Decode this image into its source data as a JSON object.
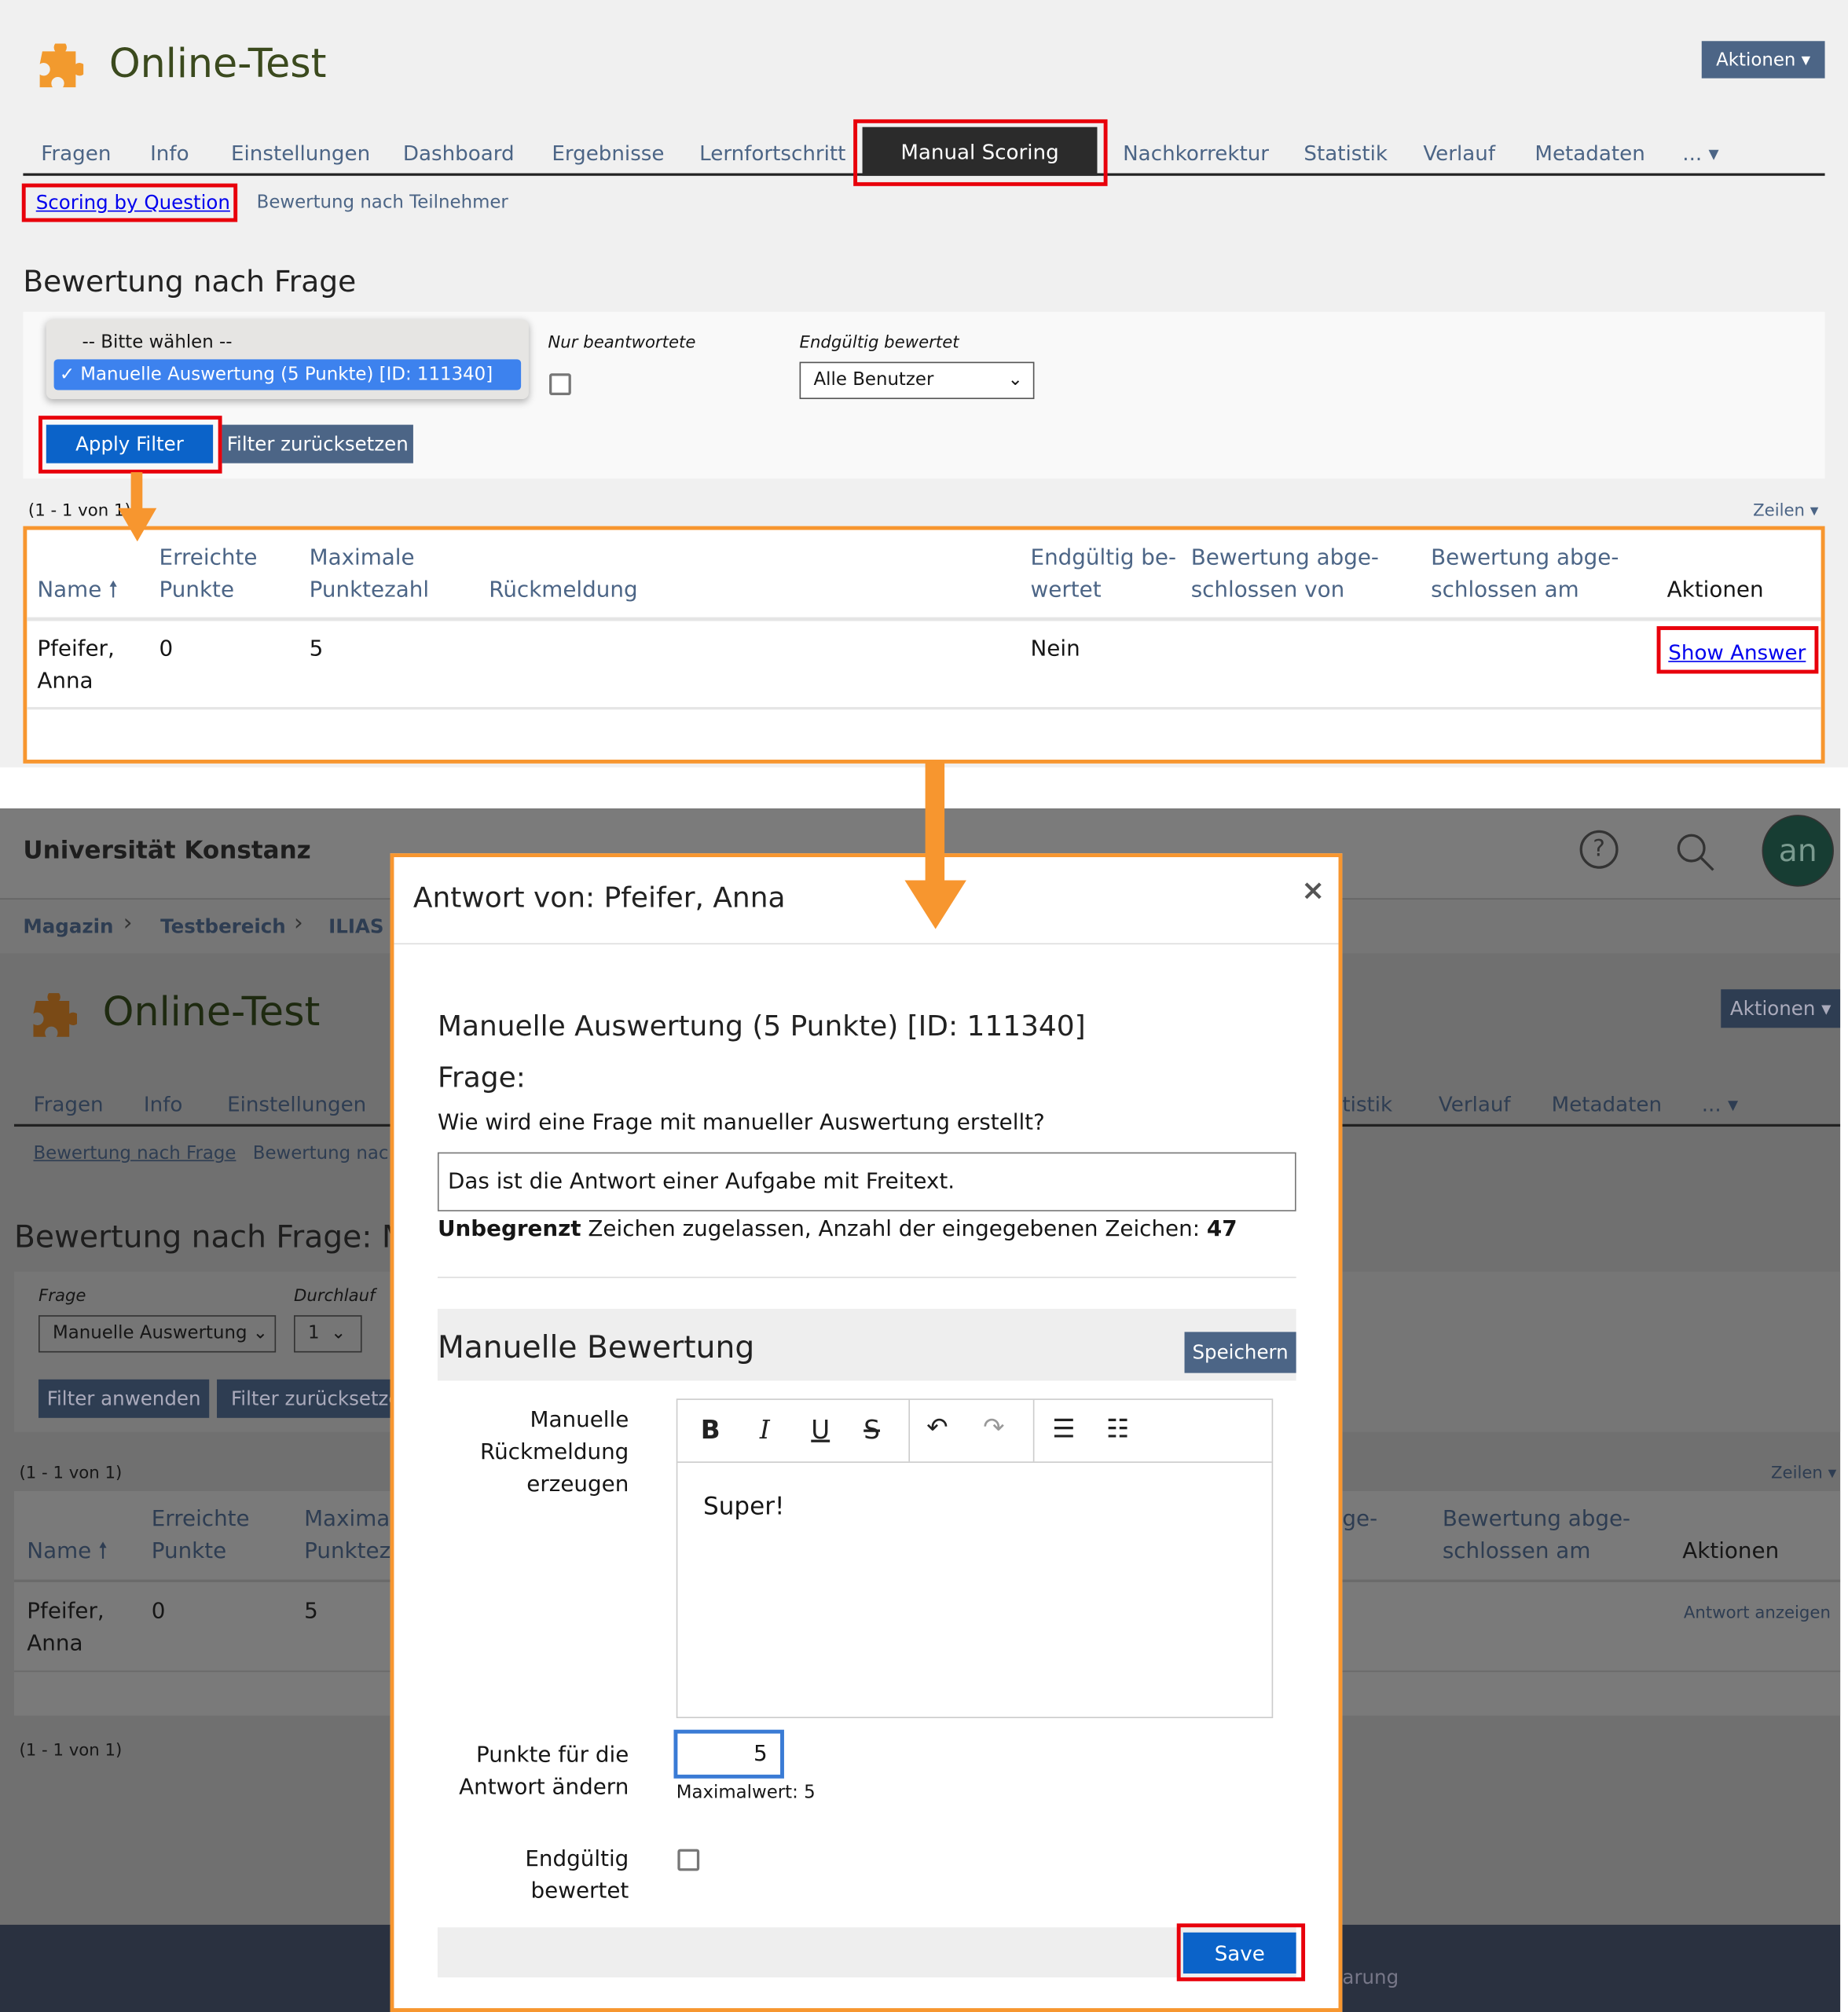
{
  "top": {
    "title": "Online-Test",
    "actions_label": "Aktionen",
    "tabs": [
      "Fragen",
      "Info",
      "Einstellungen",
      "Dashboard",
      "Ergebnisse",
      "Lernfortschritt",
      "Manual Scoring",
      "Nachkorrektur",
      "Statistik",
      "Verlauf",
      "Metadaten",
      "..."
    ],
    "subtabs": [
      "Scoring by Question",
      "Bewertung nach Teilnehmer"
    ],
    "heading": "Bewertung nach Frage",
    "filter": {
      "question_options": [
        "-- Bitte wählen --",
        "Manuelle Auswertung (5 Punkte) [ID: 111340]"
      ],
      "selected_check": "✓",
      "only_answered_label": "Nur beantwortete",
      "final_label": "Endgültig bewertet",
      "final_value": "Alle Benutzer",
      "apply_label": "Apply Filter",
      "reset_label": "Filter zurücksetzen"
    },
    "pagination": "(1 - 1 von 1)",
    "rows_label": "Zeilen",
    "table": {
      "headers": [
        "Name",
        "Erreichte Punkte",
        "Maximale Punktezahl",
        "Rückmeldung",
        "Endgültig be-wertet",
        "Bewertung abge-schlossen von",
        "Bewertung abge-schlossen am",
        "Aktionen"
      ],
      "header_lines": {
        "h1a": "Erreichte",
        "h1b": "Punkte",
        "h2a": "Maximale",
        "h2b": "Punktezahl",
        "h4a": "Endgültig be-",
        "h4b": "wertet",
        "h5a": "Bewertung abge-",
        "h5b": "schlossen von",
        "h6a": "Bewertung abge-",
        "h6b": "schlossen am"
      },
      "rows": [
        {
          "name1": "Pfeifer,",
          "name2": "Anna",
          "points": "0",
          "max": "5",
          "feedback": "",
          "final": "Nein",
          "action": "Show Answer"
        }
      ]
    }
  },
  "bottom": {
    "org": "Universität Konstanz",
    "avatar": "an",
    "breadcrumbs": [
      "Magazin",
      "Testbereich",
      "ILIAS |"
    ],
    "title": "Online-Test",
    "actions_label": "Aktionen",
    "tabs_left": [
      "Fragen",
      "Info",
      "Einstellungen"
    ],
    "tabs_right": [
      "tistik",
      "Verlauf",
      "Metadaten",
      "..."
    ],
    "subtabs": [
      "Bewertung nach Frage",
      "Bewertung nach"
    ],
    "heading": "Bewertung nach Frage: Ma",
    "frage_label": "Frage",
    "frage_value": "Manuelle Auswertung",
    "durchlauf_label": "Durchlauf",
    "durchlauf_value": "1",
    "apply_label": "Filter anwenden",
    "reset_label": "Filter zurücksetze",
    "pagination": "(1 - 1 von 1)",
    "rows_label": "Zeilen",
    "hdr": {
      "name": "Name",
      "h1a": "Erreichte",
      "h1b": "Punkte",
      "h2a": "Maxima",
      "h2b": "Punktez",
      "h5": "ge-",
      "h6a": "Bewertung abge-",
      "h6b": "schlossen am",
      "actions": "Aktionen"
    },
    "row": {
      "name1": "Pfeifer,",
      "name2": "Anna",
      "points": "0",
      "max": "5",
      "action": "Antwort anzeigen"
    },
    "footer_fragment": "arung"
  },
  "modal": {
    "title": "Antwort von: Pfeifer, Anna",
    "close": "×",
    "question_title": "Manuelle Auswertung (5 Punkte) [ID: 111340]",
    "frage_label": "Frage:",
    "question_text": "Wie wird eine Frage mit manueller Auswertung erstellt?",
    "answer": "Das ist die Antwort einer Aufgabe mit Freitext.",
    "limit_bold": "Unbegrenzt",
    "limit_text": " Zeichen zugelassen, Anzahl der eingegebenen Zeichen: ",
    "char_count": "47",
    "section_title": "Manuelle Bewertung",
    "save_top": "Speichern",
    "feedback_label": [
      "Manuelle",
      "Rückmeldung",
      "erzeugen"
    ],
    "feedback_text": "Super!",
    "points_label": [
      "Punkte für die",
      "Antwort ändern"
    ],
    "points_value": "5",
    "max_hint": "Maximalwert: 5",
    "final_label": [
      "Endgültig",
      "bewertet"
    ],
    "save_label": "Save"
  },
  "colors": {
    "accent": "#0b63c9",
    "highlight": "#e8000b",
    "arrow": "#f7962f",
    "nav": "#4c6586"
  }
}
